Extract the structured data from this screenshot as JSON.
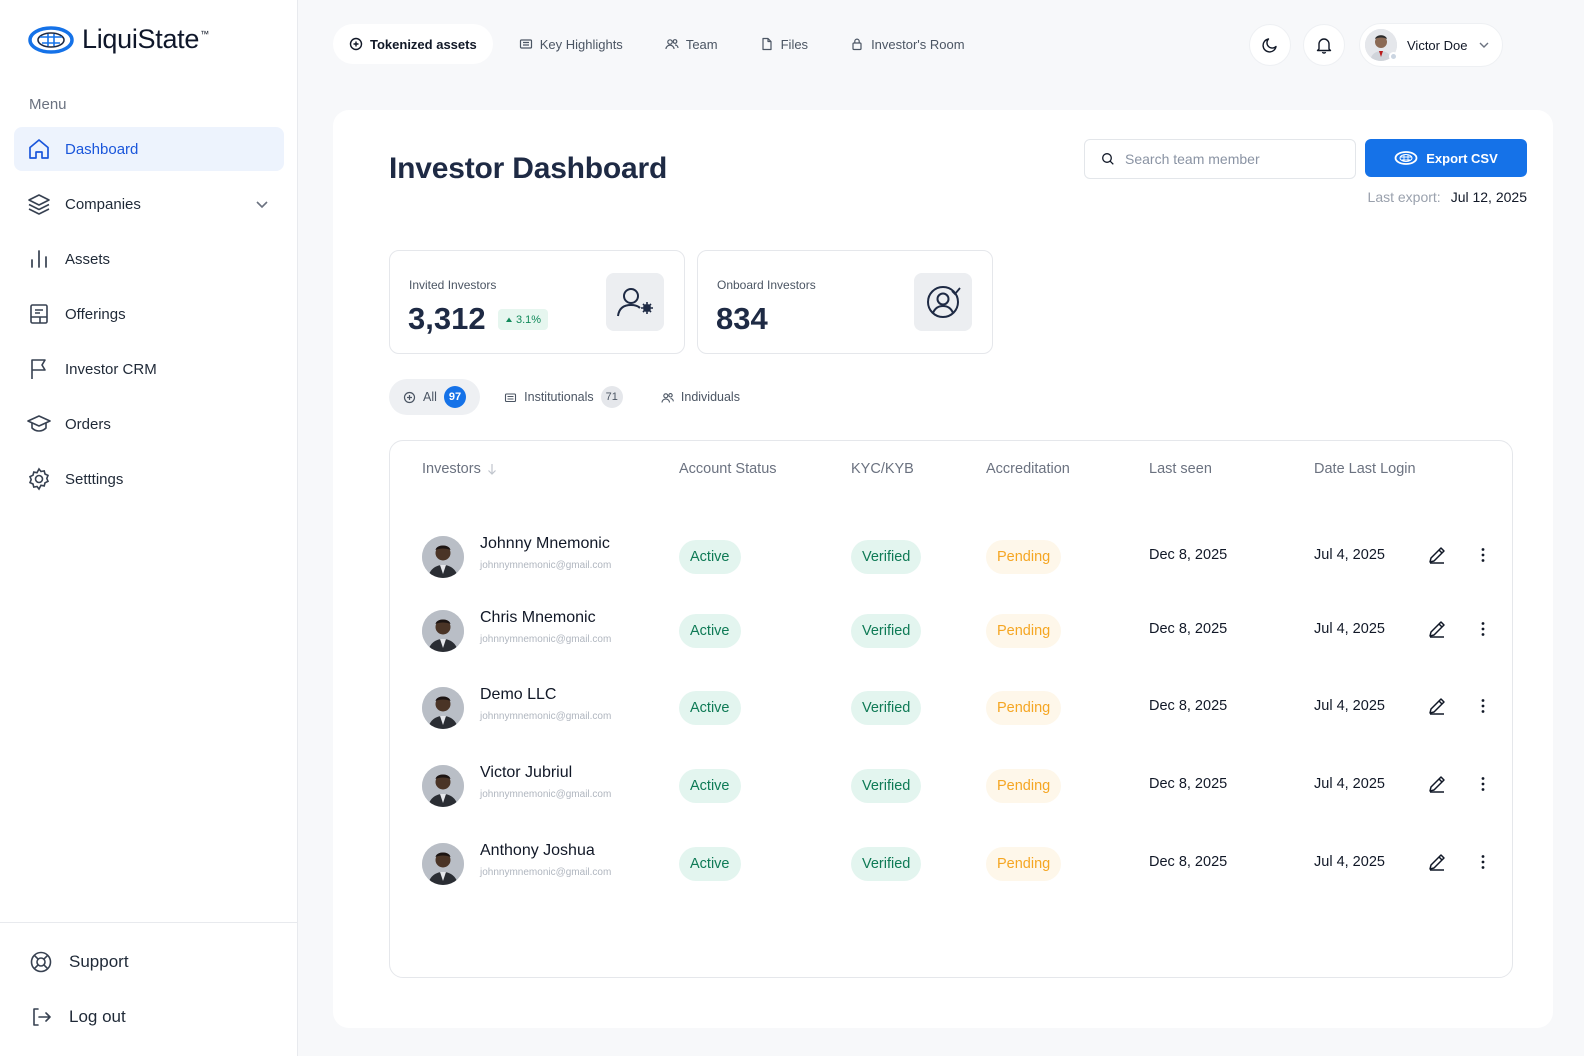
{
  "brand": {
    "name": "LiquiState",
    "trademark": "™"
  },
  "sidebar": {
    "menu_label": "Menu",
    "items": [
      {
        "label": "Dashboard",
        "icon": "home-icon",
        "active": true
      },
      {
        "label": "Companies",
        "icon": "layers-icon",
        "has_chevron": true
      },
      {
        "label": "Assets",
        "icon": "bar-chart-icon"
      },
      {
        "label": "Offerings",
        "icon": "document-icon"
      },
      {
        "label": "Investor CRM",
        "icon": "flag-icon"
      },
      {
        "label": "Orders",
        "icon": "graduation-cap-icon"
      },
      {
        "label": "Setttings",
        "icon": "gear-icon"
      }
    ],
    "bottom": [
      {
        "label": "Support",
        "icon": "lifebuoy-icon"
      },
      {
        "label": "Log out",
        "icon": "logout-icon"
      }
    ]
  },
  "topnav": {
    "tabs": [
      {
        "label": "Tokenized assets",
        "icon": "token-icon",
        "active": true
      },
      {
        "label": "Key Highlights",
        "icon": "newspaper-icon"
      },
      {
        "label": "Team",
        "icon": "users-icon"
      },
      {
        "label": "Files",
        "icon": "file-icon"
      },
      {
        "label": "Investor's Room",
        "icon": "lock-icon"
      }
    ],
    "user_name": "Victor Doe"
  },
  "page": {
    "title": "Investor Dashboard",
    "search_placeholder": "Search team member",
    "export_label": "Export CSV",
    "last_export_label": "Last export:",
    "last_export_value": "Jul 12, 2025"
  },
  "stats": [
    {
      "label": "Invited Investors",
      "value": "3,312",
      "change": "3.1%",
      "icon": "user-settings-icon"
    },
    {
      "label": "Onboard Investors",
      "value": "834",
      "icon": "user-check-icon"
    }
  ],
  "filters": [
    {
      "label": "All",
      "count": "97",
      "active": true
    },
    {
      "label": "Institutionals",
      "count": "71"
    },
    {
      "label": "Individuals",
      "count": ""
    }
  ],
  "table": {
    "headers": {
      "investors": "Investors",
      "account_status": "Account Status",
      "kyc": "KYC/KYB",
      "accreditation": "Accreditation",
      "last_seen": "Last seen",
      "date_last_login": "Date Last Login"
    },
    "rows": [
      {
        "name": "Johnny Mnemonic",
        "email": "johnnymnemonic@gmail.com",
        "status": "Active",
        "kyc": "Verified",
        "accreditation": "Pending",
        "last_seen": "Dec 8, 2025",
        "last_login": "Jul 4, 2025"
      },
      {
        "name": "Chris Mnemonic",
        "email": "johnnymnemonic@gmail.com",
        "status": "Active",
        "kyc": "Verified",
        "accreditation": "Pending",
        "last_seen": "Dec 8, 2025",
        "last_login": "Jul 4, 2025"
      },
      {
        "name": "Demo LLC",
        "email": "johnnymnemonic@gmail.com",
        "status": "Active",
        "kyc": "Verified",
        "accreditation": "Pending",
        "last_seen": "Dec 8, 2025",
        "last_login": "Jul 4, 2025"
      },
      {
        "name": "Victor Jubriul",
        "email": "johnnymnemonic@gmail.com",
        "status": "Active",
        "kyc": "Verified",
        "accreditation": "Pending",
        "last_seen": "Dec 8, 2025",
        "last_login": "Jul 4, 2025"
      },
      {
        "name": "Anthony Joshua",
        "email": "johnnymnemonic@gmail.com",
        "status": "Active",
        "kyc": "Verified",
        "accreditation": "Pending",
        "last_seen": "Dec 8, 2025",
        "last_login": "Jul 4, 2025"
      }
    ]
  },
  "colors": {
    "accent": "#1572e8",
    "active_nav_bg": "#edf3fd",
    "success_bg": "#e3f5ef",
    "success_text": "#0e7a55",
    "pending_bg": "#fef7ea",
    "pending_text": "#f5a623"
  }
}
